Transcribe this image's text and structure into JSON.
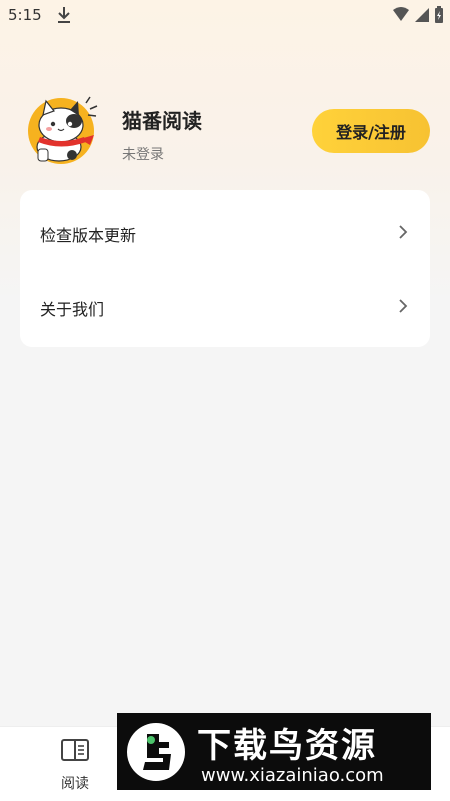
{
  "status_bar": {
    "time": "5:15"
  },
  "profile": {
    "app_name": "猫番阅读",
    "login_status": "未登录",
    "login_button": "登录/注册"
  },
  "menu": {
    "items": [
      {
        "label": "检查版本更新"
      },
      {
        "label": "关于我们"
      }
    ]
  },
  "bottom_nav": {
    "tabs": [
      {
        "label": "阅读"
      }
    ]
  },
  "watermark": {
    "title": "下载鸟资源",
    "url": "www.xiazainiao.com"
  },
  "colors": {
    "accent": "#f7c232",
    "background": "#f5f5f5",
    "card": "#ffffff"
  }
}
